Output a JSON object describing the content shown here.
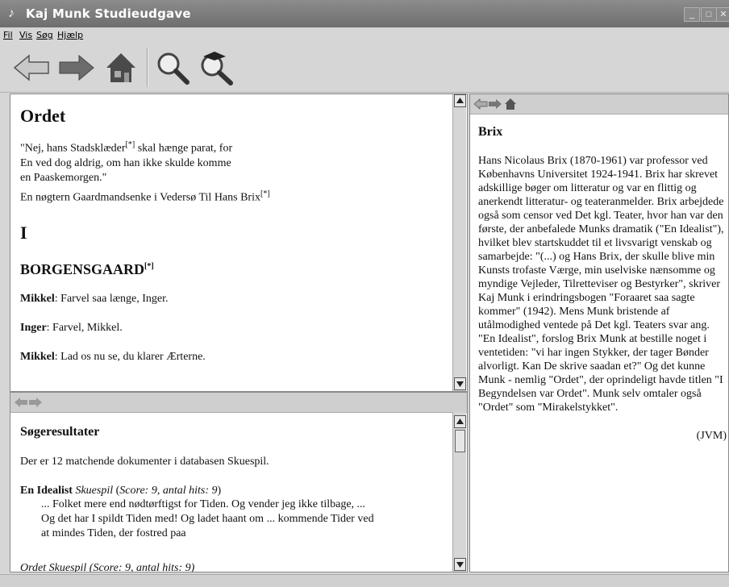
{
  "window": {
    "title": "Kaj Munk Studieudgave"
  },
  "menu": {
    "items": [
      "Fil",
      "Vis",
      "Søg",
      "Hjælp"
    ]
  },
  "document": {
    "title": "Ordet",
    "motto_1": "\"Nej, hans Stadsklæder",
    "motto_1_ref": "[*]",
    "motto_1_end": " skal hænge parat, for",
    "motto_2": "En ved dog aldrig, om han ikke skulde komme",
    "motto_3": "en Paaskemorgen.\"",
    "dedication": "En nøgtern Gaardmandsenke i Vedersø Til Hans Brix",
    "dedication_ref": "[*]",
    "act": "I",
    "scene": "BORGENSGAARD",
    "scene_ref": "[*]",
    "lines": [
      {
        "speaker": "Mikkel",
        "text": ": Farvel saa længe, Inger."
      },
      {
        "speaker": "Inger",
        "text": ": Farvel, Mikkel."
      },
      {
        "speaker": "Mikkel",
        "text": ": Lad os nu se, du klarer Ærterne."
      }
    ]
  },
  "search": {
    "heading": "Søgeresultater",
    "summary": "Der er 12 matchende dokumenter i databasen Skuespil.",
    "result1": {
      "title": "En Idealist",
      "genre": "Skuespil",
      "score_label": "Score: 9",
      "hits_label": "antal hits: 9",
      "snippet_1": "... Folket mere end nødtørftigst for Tiden. Og vender jeg ikke tilbage, ...",
      "snippet_2": "Og det har I spildt Tiden med! Og ladet haant om ... kommende Tider ved",
      "snippet_3": "at mindes Tiden, der fostred paa"
    },
    "result2_partial": "Ordet Skuespil (Score: 9, antal hits: 9)"
  },
  "note": {
    "heading": "Brix",
    "body": "Hans Nicolaus Brix (1870-1961) var professor ved Københavns Universitet 1924-1941. Brix har skrevet adskillige bøger om litteratur og var en flittig og anerkendt litteratur- og teateranmelder. Brix arbejdede også som censor ved Det kgl. Teater, hvor han var den første, der anbefalede Munks dramatik (\"En Idealist\"), hvilket blev startskuddet til et livsvarigt venskab og samarbejde: \"(...) og Hans Brix, der skulle blive min Kunsts trofaste Værge, min uselviske nænsomme og myndige Vejleder, Tilretteviser og Bestyrker\", skriver Kaj Munk i erindringsbogen \"Foraaret saa sagte kommer\" (1942). Mens Munk bristende af utålmodighed ventede på Det kgl. Teaters svar ang. \"En Idealist\", forslog Brix Munk at bestille noget i ventetiden: \"vi har ingen Stykker, der tager Bønder alvorligt. Kan De skrive saadan et?\" Og det kunne Munk - nemlig \"Ordet\", der oprindeligt havde titlen \"I Begyndelsen var Ordet\". Munk selv omtaler også \"Ordet\" som \"Mirakelstykket\".",
    "signature": "(JVM)"
  },
  "icons": {
    "back": "back-arrow-icon",
    "forward": "forward-arrow-icon",
    "home": "home-icon",
    "search": "magnifier-icon",
    "advanced_search": "advanced-search-icon"
  }
}
